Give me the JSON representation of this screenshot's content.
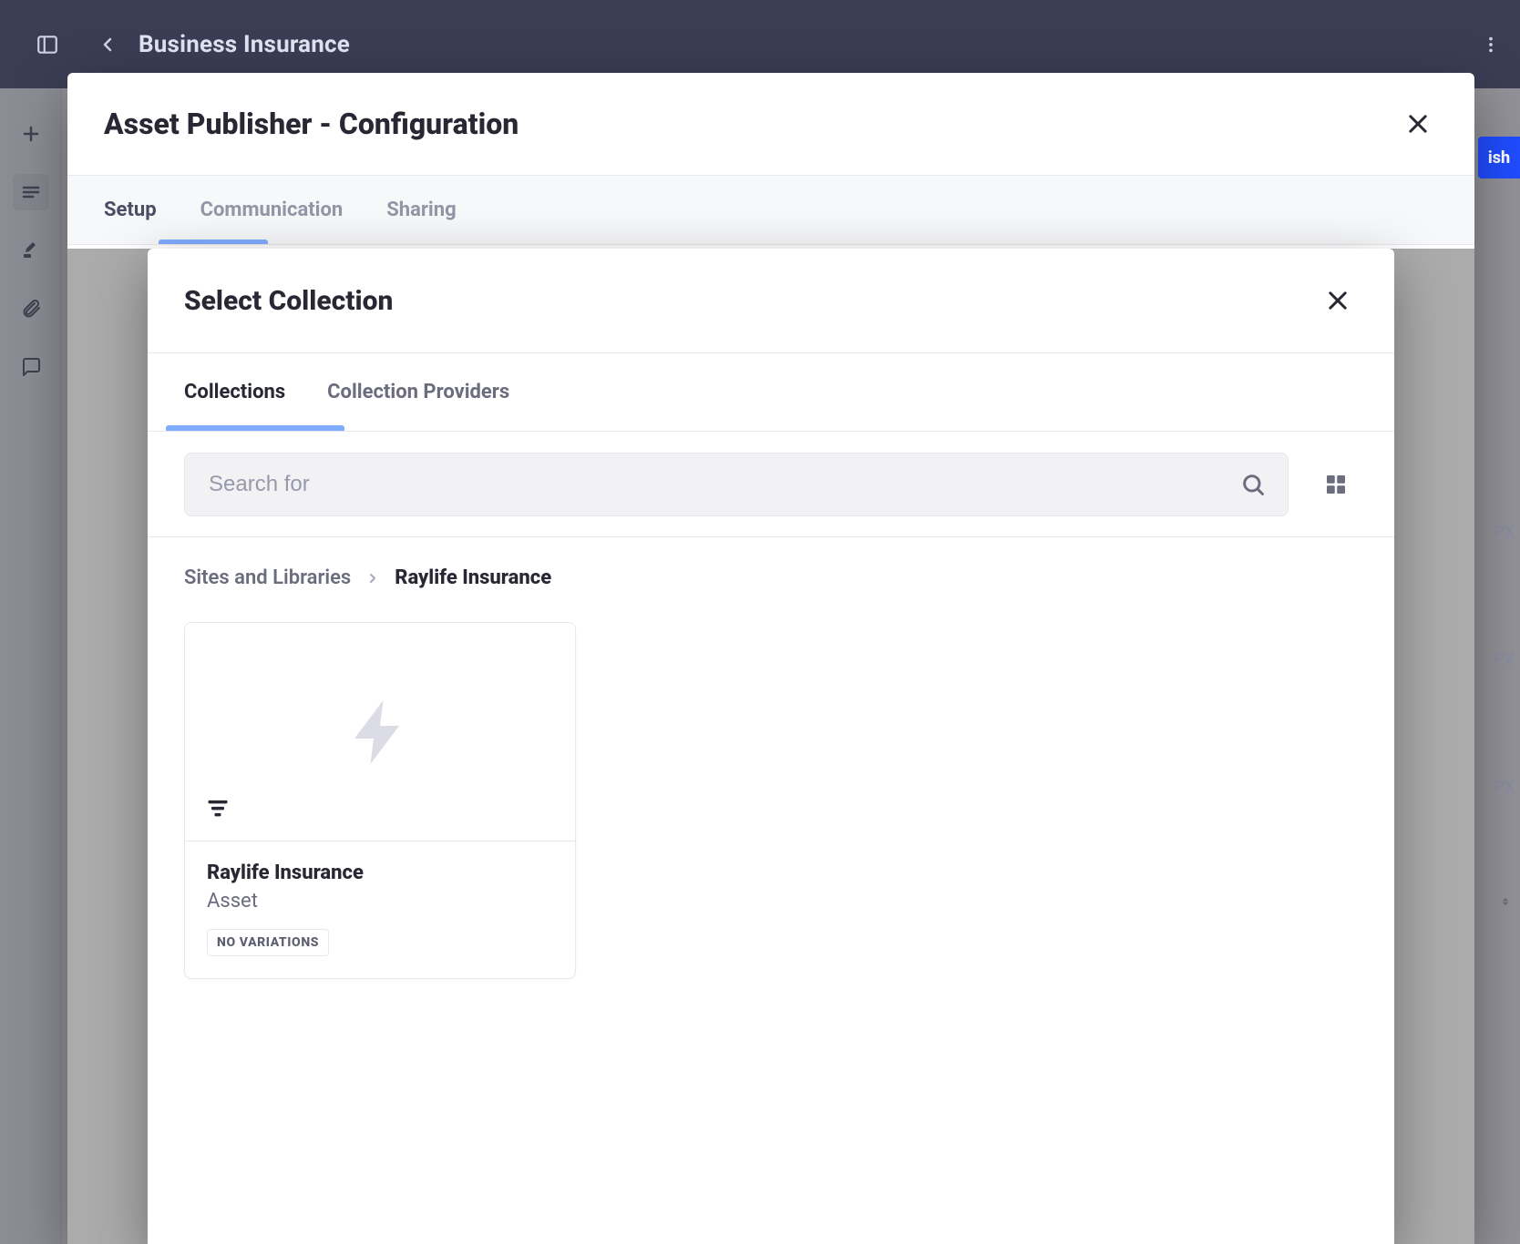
{
  "appbar": {
    "title": "Business Insurance"
  },
  "sidebar": {
    "items": [
      {
        "name": "add"
      },
      {
        "name": "rows"
      },
      {
        "name": "brush"
      },
      {
        "name": "attachment"
      },
      {
        "name": "comment"
      }
    ]
  },
  "modalOuter": {
    "title": "Asset Publisher - Configuration",
    "tabs": [
      "Setup",
      "Communication",
      "Sharing"
    ],
    "activeTab": "Setup"
  },
  "modalInner": {
    "title": "Select Collection",
    "tabs": [
      "Collections",
      "Collection Providers"
    ],
    "activeTab": "Collections",
    "search": {
      "placeholder": "Search for",
      "value": ""
    },
    "breadcrumb": {
      "root": "Sites and Libraries",
      "current": "Raylife Insurance"
    },
    "cards": [
      {
        "name": "Raylife Insurance",
        "type": "Asset",
        "badge": "NO VARIATIONS"
      }
    ]
  },
  "backgroundHints": {
    "publishLabel": "ish",
    "px1": "PX",
    "px2": "PX",
    "px3": "PX"
  }
}
